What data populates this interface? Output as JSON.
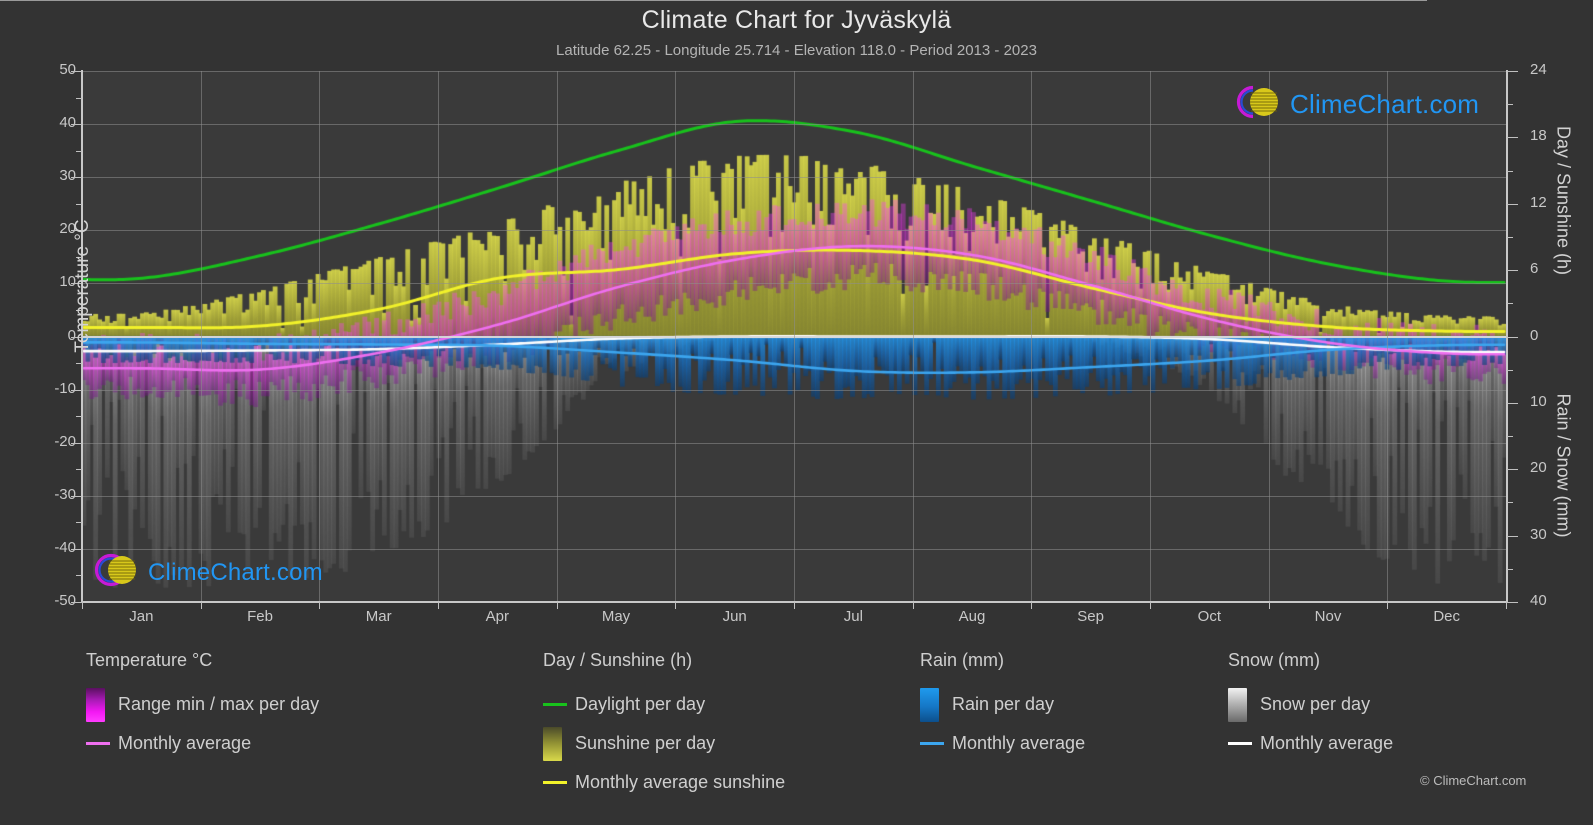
{
  "header": {
    "title": "Climate Chart for Jyväskylä",
    "subtitle": "Latitude 62.25 - Longitude 25.714 - Elevation 118.0 - Period 2013 - 2023"
  },
  "watermark": {
    "text": "ClimeChart.com"
  },
  "footer": {
    "copyright": "© ClimeChart.com"
  },
  "legend": {
    "temperature": {
      "heading": "Temperature °C",
      "items": [
        {
          "label": "Range min / max per day",
          "kind": "swatch",
          "color": "#f318f3"
        },
        {
          "label": "Monthly average",
          "kind": "line",
          "color": "#ef6ff0"
        }
      ]
    },
    "daysunshine": {
      "heading": "Day / Sunshine (h)",
      "items": [
        {
          "label": "Daylight per day",
          "kind": "line",
          "color": "#18c21c"
        },
        {
          "label": "Sunshine per day",
          "kind": "swatch",
          "color": "#d9d94a"
        },
        {
          "label": "Monthly average sunshine",
          "kind": "line",
          "color": "#f2f22a"
        }
      ]
    },
    "rain": {
      "heading": "Rain (mm)",
      "items": [
        {
          "label": "Rain per day",
          "kind": "swatch",
          "color": "#1f9aed"
        },
        {
          "label": "Monthly average",
          "kind": "line",
          "color": "#3ca6ef"
        }
      ]
    },
    "snow": {
      "heading": "Snow (mm)",
      "items": [
        {
          "label": "Snow per day",
          "kind": "swatch",
          "color": "#cfcfcf"
        },
        {
          "label": "Monthly average",
          "kind": "line",
          "color": "#ffffff"
        }
      ]
    }
  },
  "chart_data": {
    "type": "line",
    "title": "Climate Chart for Jyväskylä",
    "subtitle": "Latitude 62.25 - Longitude 25.714 - Elevation 118.0 - Period 2013 - 2023",
    "grid": true,
    "legend_position": "below",
    "xlabel": "",
    "x_categories": [
      "Jan",
      "Feb",
      "Mar",
      "Apr",
      "May",
      "Jun",
      "Jul",
      "Aug",
      "Sep",
      "Oct",
      "Nov",
      "Dec"
    ],
    "axes": {
      "left": {
        "label": "Temperature °C",
        "ticks": [
          50,
          40,
          30,
          20,
          10,
          0,
          -10,
          -20,
          -30,
          -40,
          -50
        ],
        "range": [
          -50,
          50
        ]
      },
      "right_top": {
        "label": "Day / Sunshine (h)",
        "ticks": [
          24,
          18,
          12,
          6,
          0
        ],
        "range": [
          0,
          24
        ],
        "maps_to_temperature": [
          0,
          50
        ]
      },
      "right_bottom": {
        "label": "Rain / Snow (mm)",
        "ticks": [
          0,
          10,
          20,
          30,
          40
        ],
        "range": [
          0,
          40
        ],
        "maps_to_temperature": [
          0,
          -50
        ]
      }
    },
    "series": [
      {
        "name": "Daylight per day",
        "color": "#18c21c",
        "unit": "h",
        "axis": "right_top",
        "values_monthly": [
          5.6,
          7.6,
          10.4,
          13.6,
          16.6,
          19.2,
          18.4,
          15.4,
          12.4,
          9.4,
          6.7,
          5.2
        ],
        "values_temp_scale": [
          11.0,
          15.3,
          21.3,
          28.0,
          35.0,
          40.5,
          38.5,
          32.0,
          25.5,
          19.0,
          13.6,
          10.4
        ]
      },
      {
        "name": "Monthly average sunshine",
        "color": "#f2f22a",
        "unit": "h",
        "axis": "right_top",
        "values_monthly": [
          0.8,
          1.0,
          2.5,
          5.3,
          6.1,
          7.5,
          7.8,
          6.9,
          4.4,
          2.1,
          0.9,
          0.5
        ],
        "values_temp_scale": [
          1.7,
          2.0,
          5.2,
          11.0,
          12.6,
          15.6,
          16.2,
          14.4,
          9.1,
          4.3,
          1.8,
          1.0
        ]
      },
      {
        "name": "Temperature monthly average",
        "color": "#ef6ff0",
        "unit": "°C",
        "axis": "left",
        "values_monthly": [
          -6.0,
          -6.2,
          -3.0,
          2.3,
          9.3,
          14.5,
          17.0,
          15.3,
          9.6,
          3.2,
          -1.2,
          -3.2
        ]
      },
      {
        "name": "Rain monthly average",
        "color": "#3ca6ef",
        "unit": "mm",
        "axis": "right_bottom",
        "values_monthly": [
          0.9,
          1.1,
          1.2,
          1.4,
          2.4,
          3.6,
          5.2,
          5.4,
          4.6,
          3.6,
          2.0,
          1.3
        ]
      },
      {
        "name": "Snow monthly average",
        "color": "#ffffff",
        "unit": "mm",
        "axis": "right_bottom",
        "values_monthly": [
          2.2,
          2.1,
          1.9,
          1.2,
          0.3,
          0.0,
          0.0,
          0.0,
          0.0,
          0.4,
          1.6,
          2.3
        ]
      }
    ],
    "bands": [
      {
        "name": "Temperature range min / max per day",
        "color_min": "#5a1060",
        "color_max": "#f318f3",
        "axis": "left",
        "max_monthly": [
          -2.0,
          -2.5,
          1.5,
          8.0,
          16.0,
          21.0,
          23.0,
          21.0,
          14.5,
          7.0,
          1.8,
          -0.5
        ],
        "min_monthly": [
          -10.0,
          -10.5,
          -7.0,
          -2.5,
          3.5,
          8.5,
          11.5,
          10.0,
          5.0,
          0.0,
          -4.0,
          -6.5
        ]
      },
      {
        "name": "Sunshine per day",
        "color": "#d9d94a",
        "axis": "right_top",
        "max_monthly": [
          2.2,
          4.3,
          7.3,
          10.4,
          13.9,
          16.4,
          15.9,
          13.1,
          9.6,
          6.0,
          3.0,
          1.9
        ]
      },
      {
        "name": "Rain per day",
        "color": "#1f9aed",
        "axis": "right_bottom",
        "max_monthly": [
          4.0,
          4.0,
          4.5,
          5.0,
          7.5,
          9.0,
          9.5,
          9.5,
          9.0,
          8.0,
          6.0,
          4.5
        ]
      },
      {
        "name": "Snow per day",
        "color": "#9a9a9a",
        "axis": "right_bottom",
        "max_monthly": [
          38.0,
          37.0,
          34.0,
          22.0,
          6.0,
          0.0,
          0.0,
          0.0,
          1.0,
          9.0,
          28.0,
          38.0
        ]
      }
    ]
  }
}
